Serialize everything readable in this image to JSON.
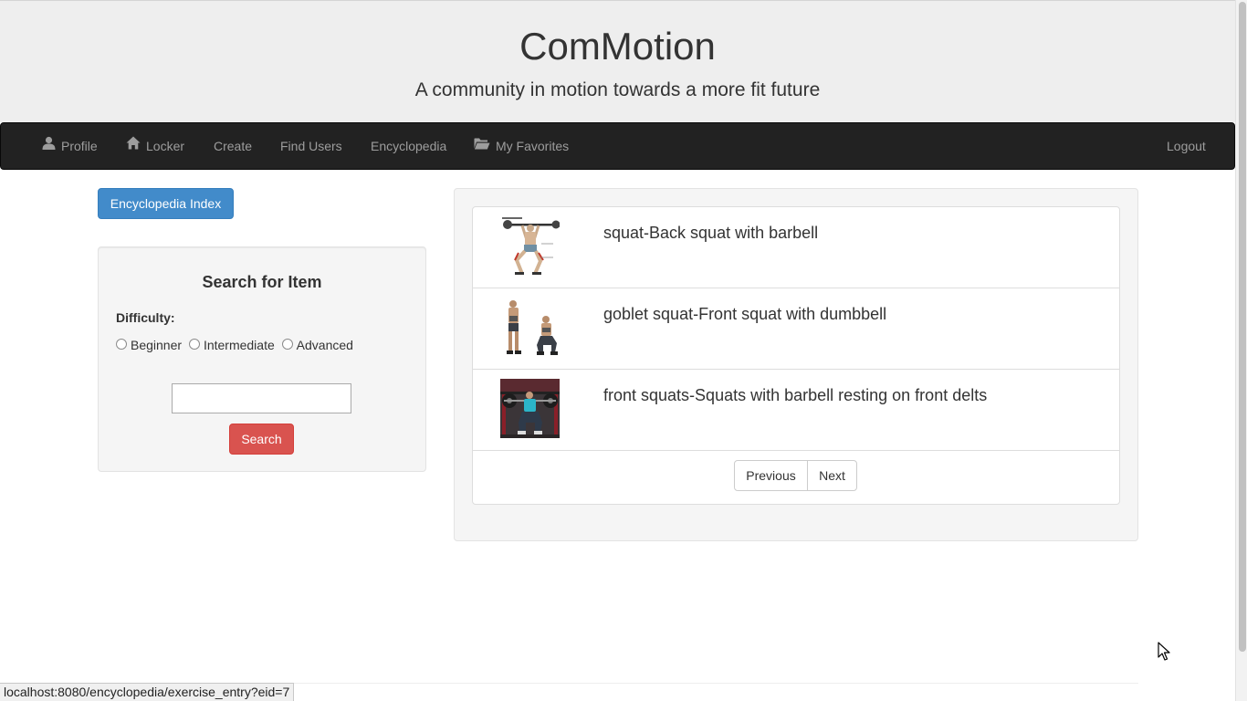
{
  "header": {
    "title": "ComMotion",
    "tagline": "A community in motion towards a more fit future"
  },
  "navbar": {
    "items": [
      {
        "label": "Profile",
        "icon": "user-icon"
      },
      {
        "label": "Locker",
        "icon": "home-icon"
      },
      {
        "label": "Create"
      },
      {
        "label": "Find Users"
      },
      {
        "label": "Encyclopedia"
      },
      {
        "label": "My Favorites",
        "icon": "folder-open-icon"
      }
    ],
    "logout": "Logout"
  },
  "sidebar": {
    "index_button": "Encyclopedia Index",
    "search_title": "Search for Item",
    "difficulty_label": "Difficulty:",
    "difficulty_options": [
      "Beginner",
      "Intermediate",
      "Advanced"
    ],
    "search_value": "",
    "search_button": "Search"
  },
  "results": {
    "items": [
      {
        "title": "squat-Back squat with barbell"
      },
      {
        "title": "goblet squat-Front squat with dumbbell"
      },
      {
        "title": "front squats-Squats with barbell resting on front delts"
      }
    ],
    "pager": {
      "previous": "Previous",
      "next": "Next"
    }
  },
  "status_bar": {
    "url": "localhost:8080/encyclopedia/exercise_entry?eid=7"
  },
  "colors": {
    "primary": "#428bca",
    "danger": "#d9534f",
    "navbar": "#222222",
    "jumbotron": "#eeeeee"
  }
}
